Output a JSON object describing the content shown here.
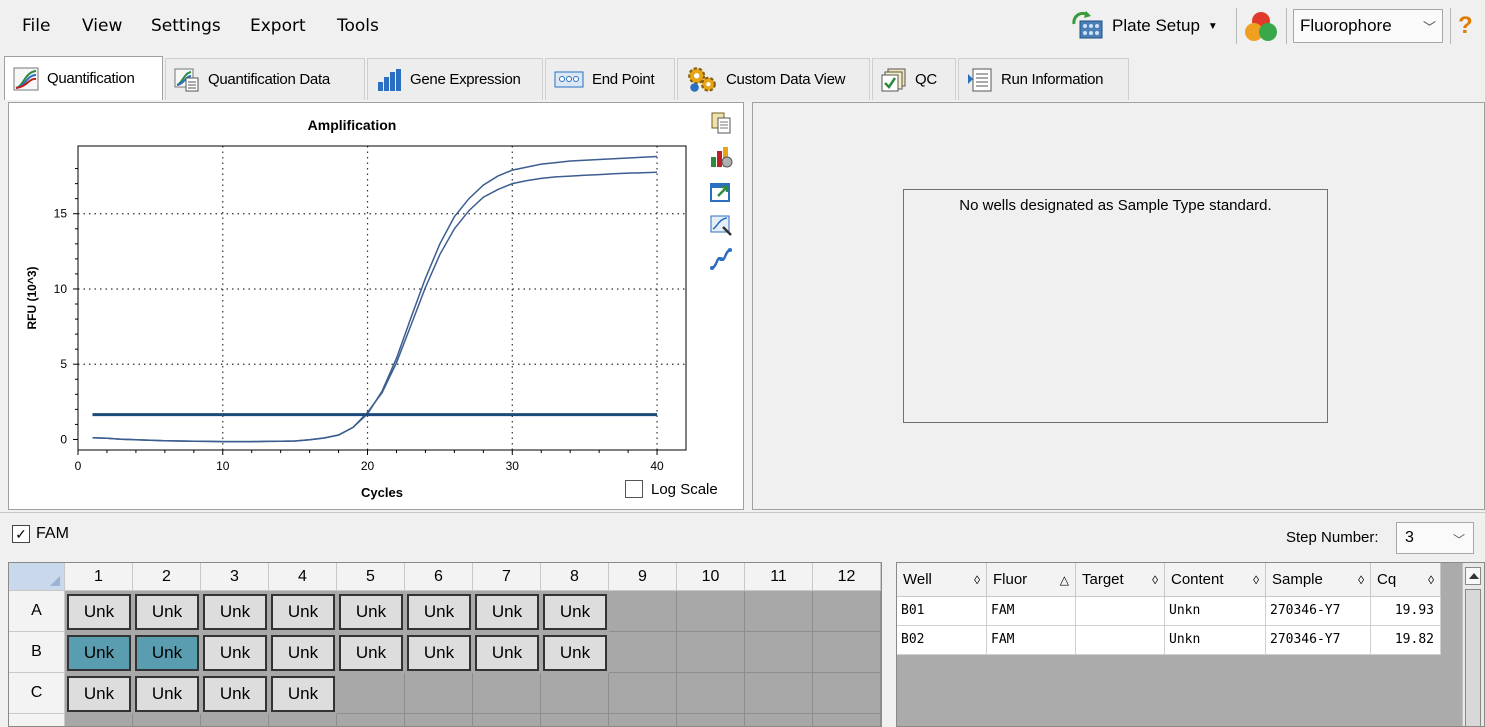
{
  "menu": {
    "items": [
      "File",
      "View",
      "Settings",
      "Export",
      "Tools"
    ],
    "plate_setup_label": "Plate Setup",
    "fluorophore_value": "Fluorophore",
    "help": "?"
  },
  "tabs": [
    {
      "label": "Quantification",
      "icon": "amplification-curve-icon",
      "active": true
    },
    {
      "label": "Quantification Data",
      "icon": "quantification-data-icon",
      "active": false
    },
    {
      "label": "Gene Expression",
      "icon": "bar-chart-icon",
      "active": false
    },
    {
      "label": "End Point",
      "icon": "end-point-icon",
      "active": false
    },
    {
      "label": "Custom Data View",
      "icon": "gear-cluster-icon",
      "active": false
    },
    {
      "label": "QC",
      "icon": "qc-checklist-icon",
      "active": false
    },
    {
      "label": "Run Information",
      "icon": "run-info-icon",
      "active": false
    }
  ],
  "chart_data": {
    "type": "line",
    "title": "Amplification",
    "xlabel": "Cycles",
    "ylabel": "RFU (10^3)",
    "xlim": [
      0,
      42
    ],
    "ylim": [
      -0.7,
      19.5
    ],
    "xticks": [
      0,
      10,
      20,
      30,
      40
    ],
    "yticks": [
      0,
      5,
      10,
      15
    ],
    "grid": "dotted",
    "threshold": 1.65,
    "series": [
      {
        "x": [
          1,
          2,
          3,
          4,
          5,
          6,
          7,
          8,
          9,
          10,
          11,
          12,
          13,
          14,
          15,
          16,
          17,
          18,
          19,
          20,
          21,
          22,
          23,
          24,
          25,
          26,
          27,
          28,
          29,
          30,
          31,
          32,
          33,
          34,
          35,
          36,
          37,
          38,
          39,
          40
        ],
        "y": [
          0.12,
          0.08,
          0.02,
          -0.02,
          -0.05,
          -0.08,
          -0.1,
          -0.12,
          -0.13,
          -0.14,
          -0.14,
          -0.14,
          -0.13,
          -0.12,
          -0.1,
          -0.02,
          0.1,
          0.3,
          0.8,
          1.7,
          3.2,
          5.4,
          8.1,
          10.7,
          13.0,
          14.8,
          16.0,
          16.9,
          17.5,
          17.9,
          18.1,
          18.3,
          18.4,
          18.5,
          18.55,
          18.6,
          18.65,
          18.7,
          18.75,
          18.8
        ]
      },
      {
        "x": [
          1,
          2,
          3,
          4,
          5,
          6,
          7,
          8,
          9,
          10,
          11,
          12,
          13,
          14,
          15,
          16,
          17,
          18,
          19,
          20,
          21,
          22,
          23,
          24,
          25,
          26,
          27,
          28,
          29,
          30,
          31,
          32,
          33,
          34,
          35,
          36,
          37,
          38,
          39,
          40
        ],
        "y": [
          0.12,
          0.08,
          0.02,
          -0.02,
          -0.05,
          -0.08,
          -0.1,
          -0.12,
          -0.13,
          -0.14,
          -0.14,
          -0.14,
          -0.13,
          -0.12,
          -0.1,
          -0.02,
          0.1,
          0.3,
          0.8,
          1.8,
          3.1,
          5.1,
          7.6,
          10.1,
          12.3,
          14.0,
          15.2,
          16.1,
          16.6,
          17.0,
          17.2,
          17.35,
          17.45,
          17.5,
          17.55,
          17.6,
          17.65,
          17.7,
          17.72,
          17.75
        ]
      }
    ]
  },
  "chart_tools": [
    "copy-icon",
    "chart-settings-icon",
    "export-chart-icon",
    "zoom-chart-icon",
    "curve-style-icon"
  ],
  "log_scale_label": "Log Scale",
  "std_message": "No wells designated as Sample Type standard.",
  "fam_label": "FAM",
  "step_label": "Step Number:",
  "step_value": "3",
  "plate": {
    "columns": [
      "1",
      "2",
      "3",
      "4",
      "5",
      "6",
      "7",
      "8",
      "9",
      "10",
      "11",
      "12"
    ],
    "rows": [
      "A",
      "B",
      "C"
    ],
    "wells": [
      [
        "Unk",
        "Unk",
        "Unk",
        "Unk",
        "Unk",
        "Unk",
        "Unk",
        "Unk",
        "",
        "",
        "",
        ""
      ],
      [
        "Unk",
        "Unk",
        "Unk",
        "Unk",
        "Unk",
        "Unk",
        "Unk",
        "Unk",
        "",
        "",
        "",
        ""
      ],
      [
        "Unk",
        "Unk",
        "Unk",
        "Unk",
        "",
        "",
        "",
        "",
        "",
        "",
        "",
        ""
      ]
    ],
    "selected": [
      "B1",
      "B2"
    ]
  },
  "table": {
    "headers": [
      "Well",
      "Fluor",
      "Target",
      "Content",
      "Sample",
      "Cq"
    ],
    "sort_marks": [
      "◊",
      "△",
      "◊",
      "◊",
      "◊",
      "◊"
    ],
    "rows": [
      [
        "B01",
        "FAM",
        "",
        "Unkn",
        "270346-Y7",
        "19.93"
      ],
      [
        "B02",
        "FAM",
        "",
        "Unkn",
        "270346-Y7",
        "19.82"
      ]
    ]
  }
}
